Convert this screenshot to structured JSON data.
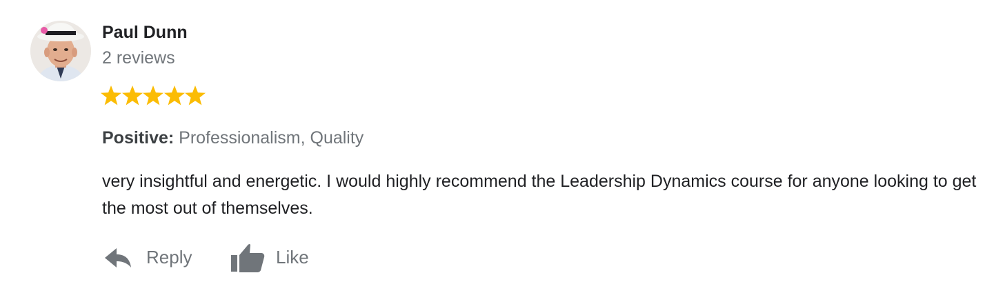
{
  "review": {
    "author": "Paul Dunn",
    "review_count": "2 reviews",
    "rating": 5,
    "rating_max": 5,
    "star_color": "#fbbc04",
    "avatar_icon": "profile-photo",
    "attributes": {
      "label": "Positive:",
      "value": "Professionalism, Quality"
    },
    "text": "very insightful and energetic. I would highly recommend the Leadership Dynamics course for anyone looking to get the most out of themselves.",
    "actions": {
      "reply": {
        "label": "Reply",
        "icon": "reply-arrow-icon"
      },
      "like": {
        "label": "Like",
        "icon": "thumbs-up-icon"
      }
    }
  },
  "colors": {
    "primary_text": "#202124",
    "secondary_text": "#70757a",
    "icon": "#70757a"
  }
}
